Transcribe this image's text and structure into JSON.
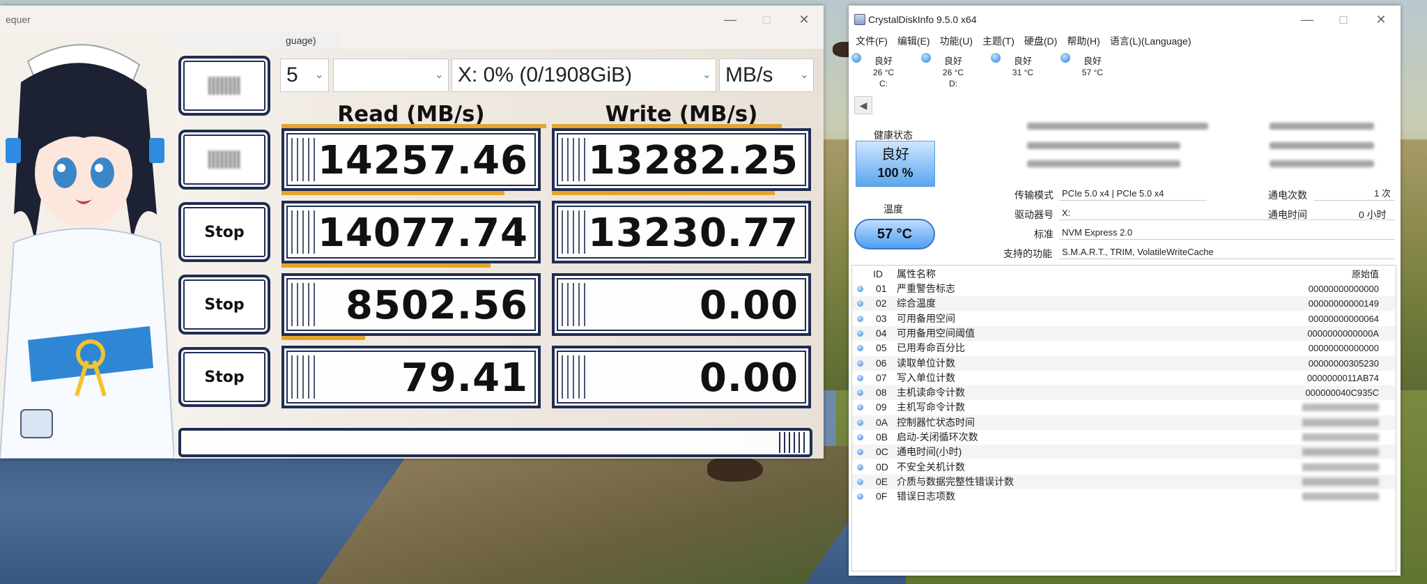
{
  "cdm": {
    "title": "equer",
    "menu_partial": "guage)",
    "controls": {
      "count": "5",
      "drive": "X: 0% (0/1908GiB)",
      "unit": "MB/s"
    },
    "headers": {
      "read": "Read (MB/s)",
      "write": "Write (MB/s)"
    },
    "buttons": [
      "",
      "Stop",
      "Stop",
      "Stop"
    ],
    "rows": [
      {
        "read": "14257.46",
        "write": "13282.25"
      },
      {
        "read": "14077.74",
        "write": "13230.77"
      },
      {
        "read": "8502.56",
        "write": "0.00"
      },
      {
        "read": "79.41",
        "write": "0.00"
      }
    ]
  },
  "cdi": {
    "title": "CrystalDiskInfo 9.5.0 x64",
    "menu": [
      "文件(F)",
      "编辑(E)",
      "功能(U)",
      "主题(T)",
      "硬盘(D)",
      "帮助(H)",
      "语言(L)(Language)"
    ],
    "drives": [
      {
        "status": "良好",
        "temp": "26 °C",
        "letter": "C:"
      },
      {
        "status": "良好",
        "temp": "26 °C",
        "letter": "D:"
      },
      {
        "status": "良好",
        "temp": "31 °C",
        "letter": ""
      },
      {
        "status": "良好",
        "temp": "57 °C",
        "letter": ""
      }
    ],
    "health_label": "健康状态",
    "health_status": "良好",
    "health_percent": "100 %",
    "temp_label": "温度",
    "temp_value": "57 °C",
    "info": {
      "transfer_label": "传输模式",
      "transfer_value": "PCIe 5.0 x4 | PCIe 5.0 x4",
      "driveletter_label": "驱动器号",
      "driveletter_value": "X:",
      "standard_label": "标准",
      "standard_value": "NVM Express 2.0",
      "features_label": "支持的功能",
      "features_value": "S.M.A.R.T., TRIM, VolatileWriteCache",
      "powercount_label": "通电次数",
      "powercount_value": "1 次",
      "powerhours_label": "通电时间",
      "powerhours_value": "0 小时"
    },
    "smart_headers": {
      "id": "ID",
      "name": "属性名称",
      "raw": "原始值"
    },
    "smart": [
      {
        "id": "01",
        "name": "严重警告标志",
        "raw": "00000000000000"
      },
      {
        "id": "02",
        "name": "综合温度",
        "raw": "00000000000149"
      },
      {
        "id": "03",
        "name": "可用备用空间",
        "raw": "00000000000064"
      },
      {
        "id": "04",
        "name": "可用备用空间阈值",
        "raw": "0000000000000A"
      },
      {
        "id": "05",
        "name": "已用寿命百分比",
        "raw": "00000000000000"
      },
      {
        "id": "06",
        "name": "读取单位计数",
        "raw": "00000000305230"
      },
      {
        "id": "07",
        "name": "写入单位计数",
        "raw": "0000000011AB74"
      },
      {
        "id": "08",
        "name": "主机读命令计数",
        "raw": "000000040C935C"
      },
      {
        "id": "09",
        "name": "主机写命令计数",
        "raw": ""
      },
      {
        "id": "0A",
        "name": "控制器忙状态时间",
        "raw": ""
      },
      {
        "id": "0B",
        "name": "启动-关闭循环次数",
        "raw": ""
      },
      {
        "id": "0C",
        "name": "通电时间(小时)",
        "raw": ""
      },
      {
        "id": "0D",
        "name": "不安全关机计数",
        "raw": ""
      },
      {
        "id": "0E",
        "name": "介质与数据完整性错误计数",
        "raw": ""
      },
      {
        "id": "0F",
        "name": "错误日志项数",
        "raw": ""
      }
    ]
  }
}
